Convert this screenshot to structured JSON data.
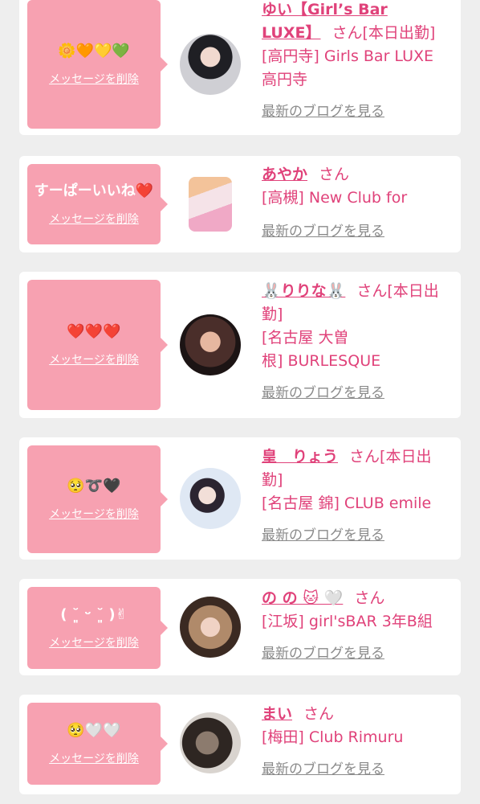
{
  "delete_label": "メッセージを削除",
  "blog_label": "最新のブログを見る",
  "suffix": "さん",
  "accent_color": "#e0427a",
  "bubble_color": "#f7a1b1",
  "cards": [
    {
      "message": "🌼🧡💛💚",
      "name_line1": "ゆい【Girl’s Bar",
      "name_line2": "LUXE】",
      "status": "[本日出勤]",
      "shop_line1": "[高円寺] Girls Bar LUXE",
      "shop_line2": "高円寺"
    },
    {
      "message": "すーぱーいいね❤️",
      "name": "あやか",
      "shop_line1": "[高槻] New Club for"
    },
    {
      "message": "❤️❤️❤️",
      "name": "🐰りりな🐰",
      "status_part1": "[本日出",
      "status_part2": "勤]",
      "shop_line1": "[名古屋 大曽",
      "shop_line2": "根] BURLESQUE"
    },
    {
      "message": "🥺➰🖤",
      "name": "皇　りょう",
      "status_part1": "[本日出",
      "status_part2": "勤]",
      "shop_line1": "[名古屋 錦] CLUB emile"
    },
    {
      "message": "( ˘͈ ᵕ ˘͈ )✌",
      "name": "の の 🐱 🤍",
      "shop_line1": "[江坂] girl'sBAR 3年B組"
    },
    {
      "message": "🥺🤍🤍",
      "name": "まい",
      "shop_line1": "[梅田] Club Rimuru"
    }
  ]
}
